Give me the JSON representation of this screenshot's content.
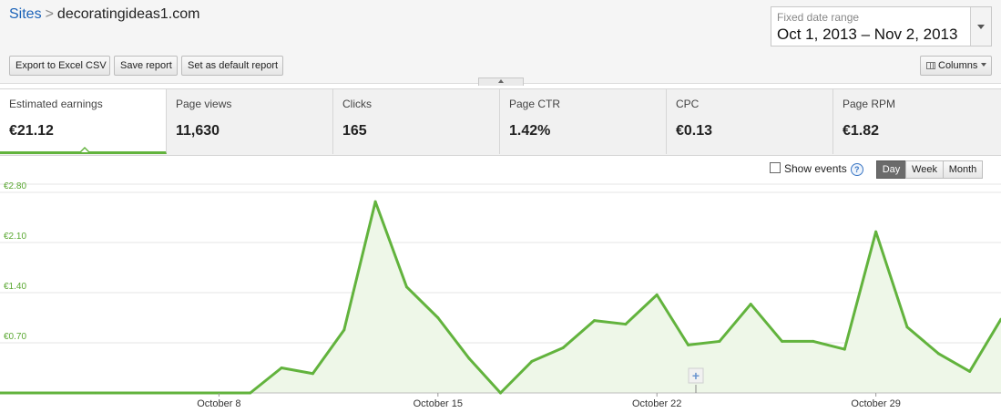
{
  "breadcrumb": {
    "root": "Sites",
    "separator": ">",
    "current": "decoratingideas1.com"
  },
  "date_range": {
    "label": "Fixed date range",
    "value": "Oct 1, 2013 – Nov 2, 2013"
  },
  "toolbar": {
    "export_label": "Export to Excel CSV",
    "save_label": "Save report",
    "default_label": "Set as default report",
    "columns_label": "Columns"
  },
  "metrics": [
    {
      "label": "Estimated earnings",
      "value": "€21.12"
    },
    {
      "label": "Page views",
      "value": "11,630"
    },
    {
      "label": "Clicks",
      "value": "165"
    },
    {
      "label": "Page CTR",
      "value": "1.42%"
    },
    {
      "label": "CPC",
      "value": "€0.13"
    },
    {
      "label": "Page RPM",
      "value": "€1.82"
    }
  ],
  "controls": {
    "show_events_label": "Show events",
    "help": "?",
    "day": "Day",
    "week": "Week",
    "month": "Month",
    "add_annotation": "+"
  },
  "colors": {
    "line": "#62b33d",
    "fill": "#eef7e8",
    "grid": "#e6e6e6",
    "axis_label": "#5aa832"
  },
  "chart_data": {
    "type": "area",
    "x": [
      "2013-10-01",
      "2013-10-02",
      "2013-10-03",
      "2013-10-04",
      "2013-10-05",
      "2013-10-06",
      "2013-10-07",
      "2013-10-08",
      "2013-10-09",
      "2013-10-10",
      "2013-10-11",
      "2013-10-12",
      "2013-10-13",
      "2013-10-14",
      "2013-10-15",
      "2013-10-16",
      "2013-10-17",
      "2013-10-18",
      "2013-10-19",
      "2013-10-20",
      "2013-10-21",
      "2013-10-22",
      "2013-10-23",
      "2013-10-24",
      "2013-10-25",
      "2013-10-26",
      "2013-10-27",
      "2013-10-28",
      "2013-10-29",
      "2013-10-30",
      "2013-10-31",
      "2013-11-01",
      "2013-11-02"
    ],
    "series": [
      {
        "values": [
          0,
          0,
          0,
          0,
          0,
          0,
          0,
          0,
          0,
          0.35,
          0.27,
          0.88,
          2.67,
          1.48,
          1.05,
          0.48,
          0,
          0.44,
          0.63,
          1.01,
          0.96,
          1.37,
          0.67,
          0.72,
          1.24,
          0.72,
          0.72,
          0.61,
          2.25,
          0.92,
          0.55,
          0.3,
          1.03
        ]
      }
    ],
    "y_ticks": [
      {
        "value": 0.7,
        "label": "€0.70"
      },
      {
        "value": 1.4,
        "label": "€1.40"
      },
      {
        "value": 2.1,
        "label": "€2.10"
      },
      {
        "value": 2.8,
        "label": "€2.80"
      }
    ],
    "x_ticks": [
      {
        "index": 7,
        "label": "October 8"
      },
      {
        "index": 14,
        "label": "October 15"
      },
      {
        "index": 21,
        "label": "October 22"
      },
      {
        "index": 28,
        "label": "October 29"
      }
    ],
    "ylim": [
      0,
      2.8
    ],
    "grid": true
  }
}
